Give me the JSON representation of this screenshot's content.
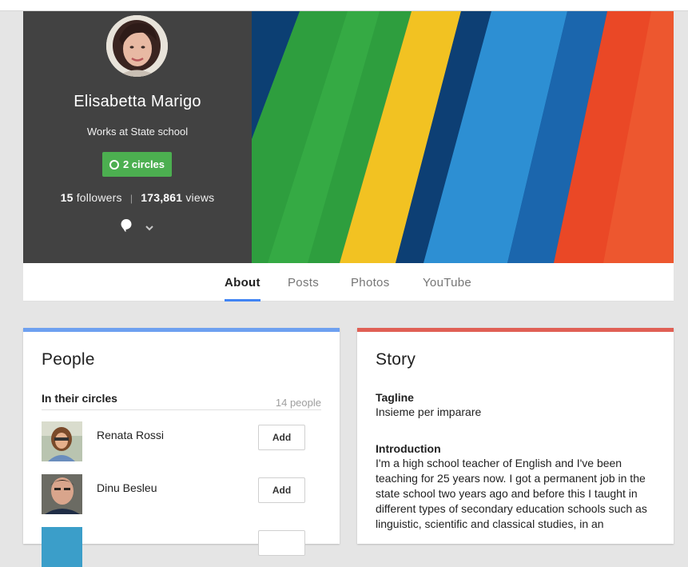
{
  "profile": {
    "name": "Elisabetta Marigo",
    "work": "Works at State school",
    "circles_label": "2 circles",
    "followers_count": "15",
    "followers_label": "followers",
    "views_count": "173,861",
    "views_label": "views",
    "separator": "|"
  },
  "tabs": [
    {
      "label": "About",
      "active": true
    },
    {
      "label": "Posts",
      "active": false
    },
    {
      "label": "Photos",
      "active": false
    },
    {
      "label": "YouTube",
      "active": false
    }
  ],
  "people": {
    "title": "People",
    "section_label": "In their circles",
    "count": "14 people",
    "persons": [
      {
        "name": "Renata Rossi",
        "button": "Add"
      },
      {
        "name": "Dinu Besleu",
        "button": "Add"
      }
    ]
  },
  "story": {
    "title": "Story",
    "tagline_heading": "Tagline",
    "tagline": "Insieme per imparare",
    "intro_heading": "Introduction",
    "intro": "I'm a high school teacher of English and I've been teaching for 25 years now. I got a permanent job in the state school two years ago and before this I taught in different types of secondary education schools such as linguistic, scientific and classical studies, in an"
  },
  "colors": {
    "profile_bg": "#424242",
    "circles_green": "#4caf50",
    "tab_underline": "#4285f4",
    "people_accent": "#6ea0f0",
    "story_accent": "#e06055"
  },
  "icons": [
    "location-pin-icon",
    "chevron-down-icon",
    "circle-icon"
  ]
}
